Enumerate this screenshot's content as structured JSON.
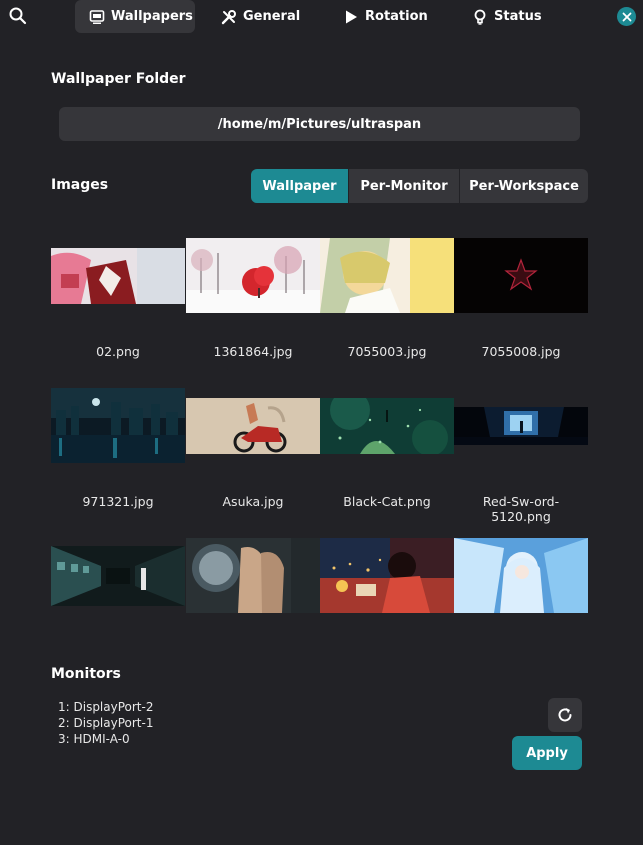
{
  "header": {
    "tabs": [
      {
        "label": "Wallpapers",
        "icon": "image-icon",
        "active": true
      },
      {
        "label": "General",
        "icon": "tools-icon",
        "active": false
      },
      {
        "label": "Rotation",
        "icon": "play-icon",
        "active": false
      },
      {
        "label": "Status",
        "icon": "lightbulb-icon",
        "active": false
      }
    ],
    "search_icon": "search-icon",
    "close_icon": "close-icon"
  },
  "wallpaper_folder": {
    "title": "Wallpaper Folder",
    "path": "/home/m/Pictures/ultraspan"
  },
  "images": {
    "title": "Images",
    "modes": [
      {
        "label": "Wallpaper",
        "active": true
      },
      {
        "label": "Per-Monitor",
        "active": false
      },
      {
        "label": "Per-Workspace",
        "active": false
      }
    ],
    "files": [
      "02.png",
      "1361864.jpg",
      "7055003.jpg",
      "7055008.jpg",
      "971321.jpg",
      "Asuka.jpg",
      "Black-Cat.png",
      "Red-Sw-ord-5120.png",
      "",
      "",
      "",
      ""
    ]
  },
  "monitors": {
    "title": "Monitors",
    "list": [
      "1: DisplayPort-2",
      "2: DisplayPort-1",
      "3: HDMI-A-0"
    ],
    "refresh_icon": "refresh-icon",
    "apply_label": "Apply"
  },
  "colors": {
    "background": "#222226",
    "button": "#36363a",
    "accent": "#1d8a93"
  }
}
